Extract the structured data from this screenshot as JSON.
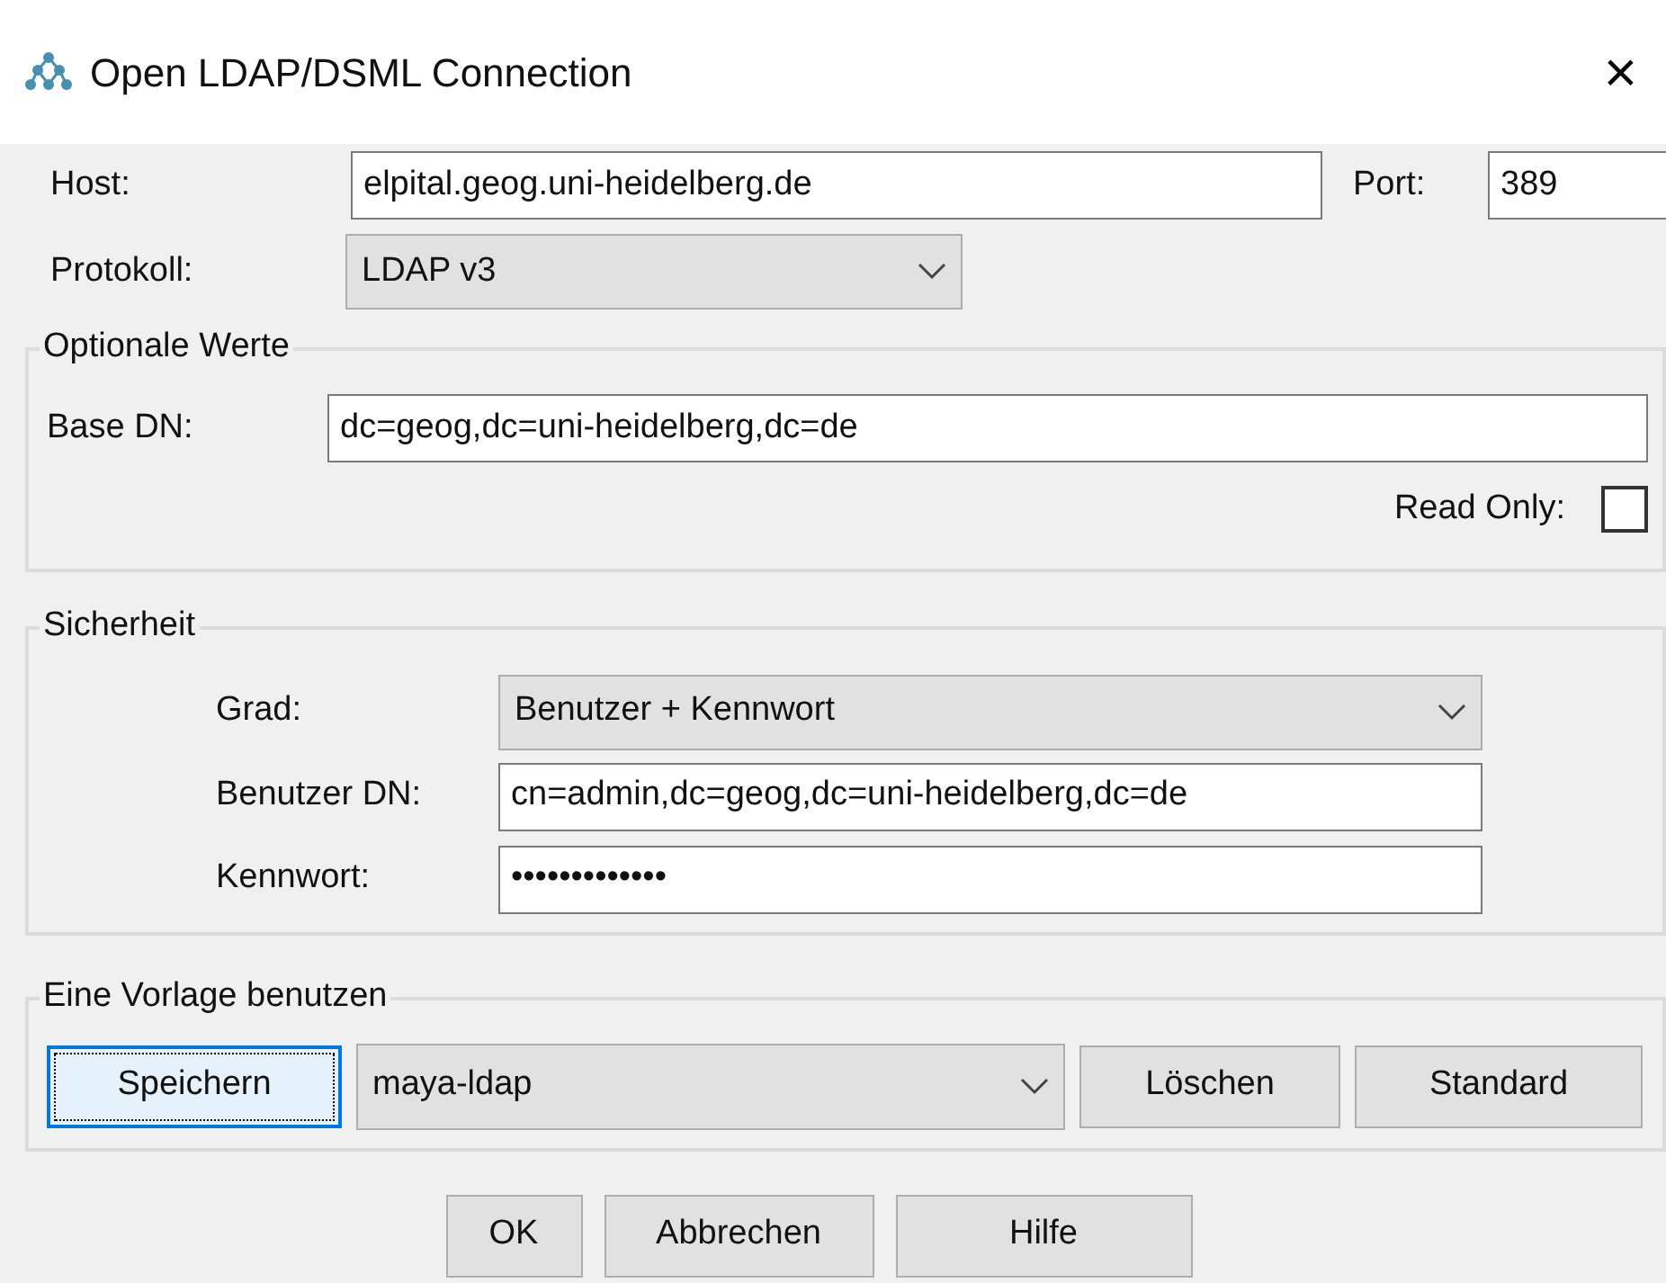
{
  "window": {
    "title": "Open LDAP/DSML Connection",
    "close": "×"
  },
  "connection": {
    "host_label": "Host:",
    "host": "elpital.geog.uni-heidelberg.de",
    "port_label": "Port:",
    "port": "389",
    "protocol_label": "Protokoll:",
    "protocol": "LDAP v3"
  },
  "optional": {
    "legend": "Optionale Werte",
    "base_dn_label": "Base DN:",
    "base_dn": "dc=geog,dc=uni-heidelberg,dc=de",
    "read_only_label": "Read Only:",
    "read_only": false
  },
  "security": {
    "legend": "Sicherheit",
    "level_label": "Grad:",
    "level": "Benutzer + Kennwort",
    "user_dn_label": "Benutzer DN:",
    "user_dn": "cn=admin,dc=geog,dc=uni-heidelberg,dc=de",
    "password_label": "Kennwort:",
    "password": "•••••••••••••"
  },
  "template": {
    "legend": "Eine Vorlage benutzen",
    "template": "maya-ldap",
    "buttons": [
      {
        "label": "Speichern",
        "focused": true
      },
      {
        "label": "Löschen",
        "focused": false
      },
      {
        "label": "Standard",
        "focused": false
      }
    ]
  },
  "buttons": [
    {
      "label": "OK"
    },
    {
      "label": "Abbrechen"
    },
    {
      "label": "Hilfe"
    }
  ]
}
